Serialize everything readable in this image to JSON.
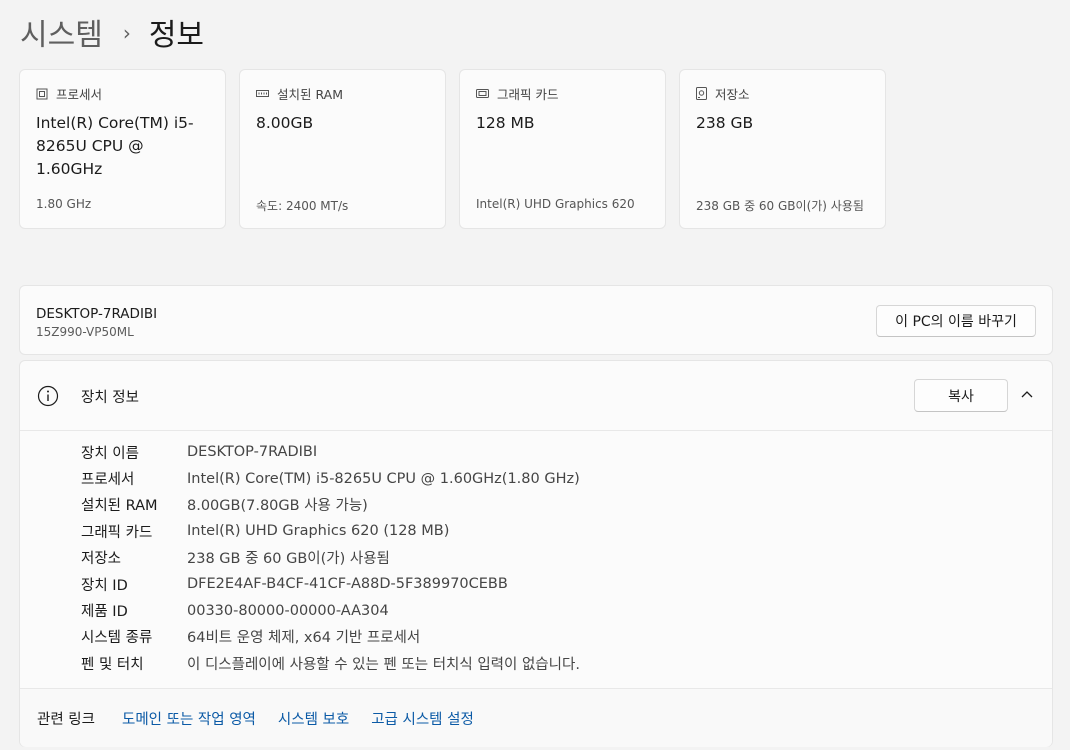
{
  "breadcrumb": {
    "parent": "시스템",
    "separator": "›",
    "current": "정보"
  },
  "cards": [
    {
      "icon": "processor-icon",
      "label": "프로세서",
      "value": "Intel(R) Core(TM) i5-8265U CPU @ 1.60GHz",
      "sub": "1.80 GHz"
    },
    {
      "icon": "ram-icon",
      "label": "설치된 RAM",
      "value": "8.00GB",
      "sub": "속도: 2400 MT/s"
    },
    {
      "icon": "graphics-card-icon",
      "label": "그래픽 카드",
      "value": "128 MB",
      "sub": "Intel(R) UHD Graphics 620"
    },
    {
      "icon": "storage-icon",
      "label": "저장소",
      "value": "238 GB",
      "sub": "238 GB 중 60 GB이(가) 사용됨"
    }
  ],
  "device": {
    "name": "DESKTOP-7RADIBI",
    "model": "15Z990-VP50ML",
    "rename_label": "이 PC의 이름 바꾸기"
  },
  "device_info": {
    "title": "장치 정보",
    "copy_label": "복사",
    "rows": [
      {
        "label": "장치 이름",
        "value": "DESKTOP-7RADIBI"
      },
      {
        "label": "프로세서",
        "value": "Intel(R) Core(TM) i5-8265U CPU @ 1.60GHz(1.80 GHz)"
      },
      {
        "label": "설치된 RAM",
        "value": "8.00GB(7.80GB 사용 가능)"
      },
      {
        "label": "그래픽 카드",
        "value": "Intel(R) UHD Graphics 620 (128 MB)"
      },
      {
        "label": "저장소",
        "value": "238 GB 중 60 GB이(가) 사용됨"
      },
      {
        "label": "장치 ID",
        "value": "DFE2E4AF-B4CF-41CF-A88D-5F389970CEBB"
      },
      {
        "label": "제품 ID",
        "value": "00330-80000-00000-AA304"
      },
      {
        "label": "시스템 종류",
        "value": "64비트 운영 체제, x64 기반 프로세서"
      },
      {
        "label": "펜 및 터치",
        "value": "이 디스플레이에 사용할 수 있는 펜 또는 터치식 입력이 없습니다."
      }
    ]
  },
  "related": {
    "label": "관련 링크",
    "links": [
      "도메인 또는 작업 영역",
      "시스템 보호",
      "고급 시스템 설정"
    ]
  },
  "colors": {
    "background": "#f3f3f3",
    "card": "#fbfbfb",
    "link": "#0b5aa6"
  }
}
